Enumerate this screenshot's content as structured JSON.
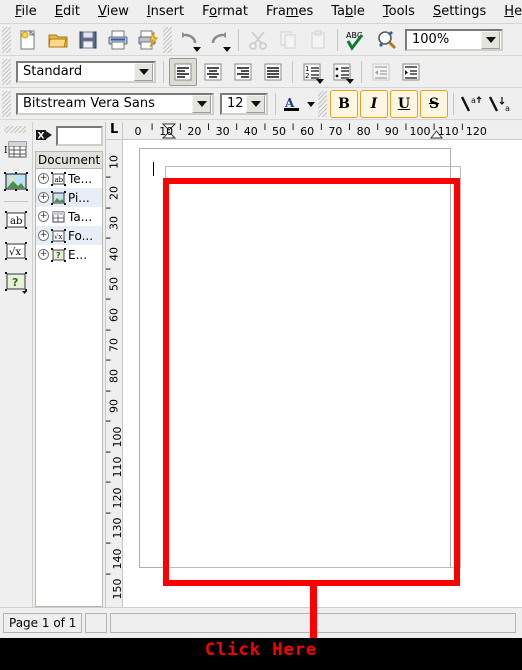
{
  "menu": {
    "items": [
      {
        "label": "File",
        "accel": "F"
      },
      {
        "label": "Edit",
        "accel": "E"
      },
      {
        "label": "View",
        "accel": "V"
      },
      {
        "label": "Insert",
        "accel": "I"
      },
      {
        "label": "Format",
        "accel": "o"
      },
      {
        "label": "Frames",
        "accel": "m"
      },
      {
        "label": "Table",
        "accel": "b"
      },
      {
        "label": "Tools",
        "accel": "T"
      },
      {
        "label": "Settings",
        "accel": "S"
      },
      {
        "label": "Help",
        "accel": "H"
      }
    ]
  },
  "toolbar_main": {
    "buttons": [
      {
        "name": "new-document-icon",
        "tip": "New"
      },
      {
        "name": "open-folder-icon",
        "tip": "Open"
      },
      {
        "name": "save-floppy-icon",
        "tip": "Save"
      },
      {
        "name": "print-icon",
        "tip": "Print"
      },
      {
        "name": "print-preview-icon",
        "tip": "Print Preview"
      },
      {
        "name": "undo-icon",
        "tip": "Undo"
      },
      {
        "name": "redo-icon",
        "tip": "Redo"
      },
      {
        "name": "cut-scissors-icon",
        "tip": "Cut"
      },
      {
        "name": "copy-icon",
        "tip": "Copy"
      },
      {
        "name": "paste-icon",
        "tip": "Paste"
      },
      {
        "name": "spellcheck-icon",
        "tip": "Spelling"
      },
      {
        "name": "find-magnifier-icon",
        "tip": "Find"
      }
    ],
    "zoom": {
      "value": "100%"
    }
  },
  "toolbar_format": {
    "style": {
      "value": "Standard"
    },
    "align": [
      "align-left",
      "align-center",
      "align-right",
      "align-justify"
    ],
    "lists": [
      "numbered-list",
      "bulleted-list"
    ],
    "indent": [
      "decrease-indent",
      "increase-indent"
    ]
  },
  "toolbar_font": {
    "family": {
      "value": "Bitstream Vera Sans"
    },
    "size": {
      "value": "12"
    },
    "font_color": "#000000",
    "bold": "B",
    "italic": "I",
    "underline": "U",
    "strikethrough": "S",
    "superscript": "a↑",
    "subscript": "a↓"
  },
  "left_tools": [
    {
      "name": "insert-table-icon"
    },
    {
      "name": "insert-image-icon"
    },
    {
      "name": "insert-text-frame-icon"
    },
    {
      "name": "insert-formula-icon"
    },
    {
      "name": "insert-object-icon"
    }
  ],
  "navigator": {
    "title": "Document",
    "items": [
      {
        "label": "Te...",
        "icon": "text-icon"
      },
      {
        "label": "Pi...",
        "icon": "picture-icon"
      },
      {
        "label": "Ta...",
        "icon": "table-icon"
      },
      {
        "label": "Fo...",
        "icon": "formula-icon"
      },
      {
        "label": "E...",
        "icon": "object-icon"
      }
    ],
    "expander": "+"
  },
  "rulers": {
    "horizontal": [
      "0",
      "10",
      "20",
      "30",
      "40",
      "50",
      "60",
      "70",
      "80",
      "90",
      "100",
      "110",
      "120"
    ],
    "vertical": [
      "10",
      "20",
      "30",
      "40",
      "50",
      "60",
      "70",
      "80",
      "90",
      "100",
      "110",
      "120",
      "130",
      "140",
      "150"
    ]
  },
  "statusbar": {
    "page": "Page 1 of 1",
    "panel2": "",
    "panel3": ""
  },
  "annotation": {
    "label": "Click Here",
    "color": "#ff0000"
  }
}
